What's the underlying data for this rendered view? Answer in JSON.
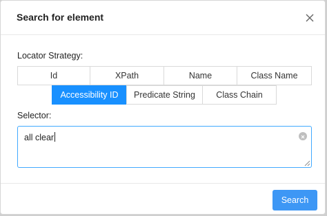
{
  "dialog": {
    "title": "Search for element"
  },
  "locator": {
    "label": "Locator Strategy:",
    "row1": [
      "Id",
      "XPath",
      "Name",
      "Class Name"
    ],
    "row2": [
      "Accessibility ID",
      "Predicate String",
      "Class Chain"
    ],
    "selected": "Accessibility ID"
  },
  "selector": {
    "label": "Selector:",
    "value": "all clear"
  },
  "footer": {
    "search_label": "Search"
  },
  "colors": {
    "accent": "#1890ff",
    "button": "#3d97f5"
  },
  "icons": {
    "close": "close-icon",
    "clear": "clear-icon",
    "resize": "resize-handle-icon"
  }
}
